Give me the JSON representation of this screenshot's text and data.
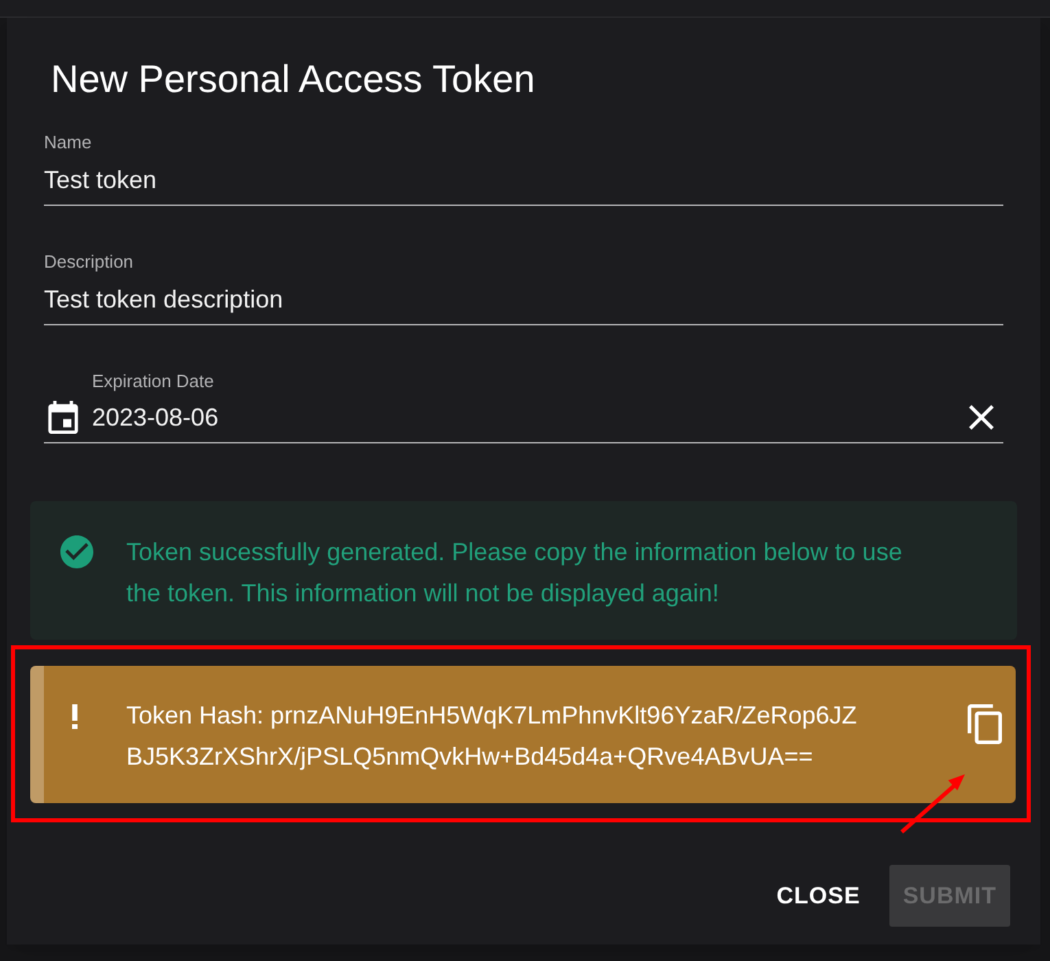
{
  "dialog": {
    "title": "New Personal Access Token"
  },
  "fields": [
    {
      "kind": "text",
      "label": "Name",
      "value": "Test token"
    },
    {
      "kind": "text",
      "label": "Description",
      "value": "Test token description"
    },
    {
      "kind": "date",
      "label": "Expiration Date",
      "value": "2023-08-06"
    }
  ],
  "alerts": [
    {
      "kind": "success",
      "text": "Token sucessfully generated. Please copy the information below to use the token. This information will not be displayed again!",
      "highlighted": false
    },
    {
      "kind": "warning",
      "text": "Token Hash: prnzANuH9EnH5WqK7LmPhnvKlt96YzaR/ZeRop6JZBJ5K3ZrXShrX/jPSLQ5nmQvkHw+Bd45d4a+QRve4ABvUA==",
      "highlighted": true
    }
  ],
  "buttons": [
    {
      "kind": "text",
      "label": "CLOSE",
      "disabled": false
    },
    {
      "kind": "contained",
      "label": "SUBMIT",
      "disabled": true
    }
  ]
}
